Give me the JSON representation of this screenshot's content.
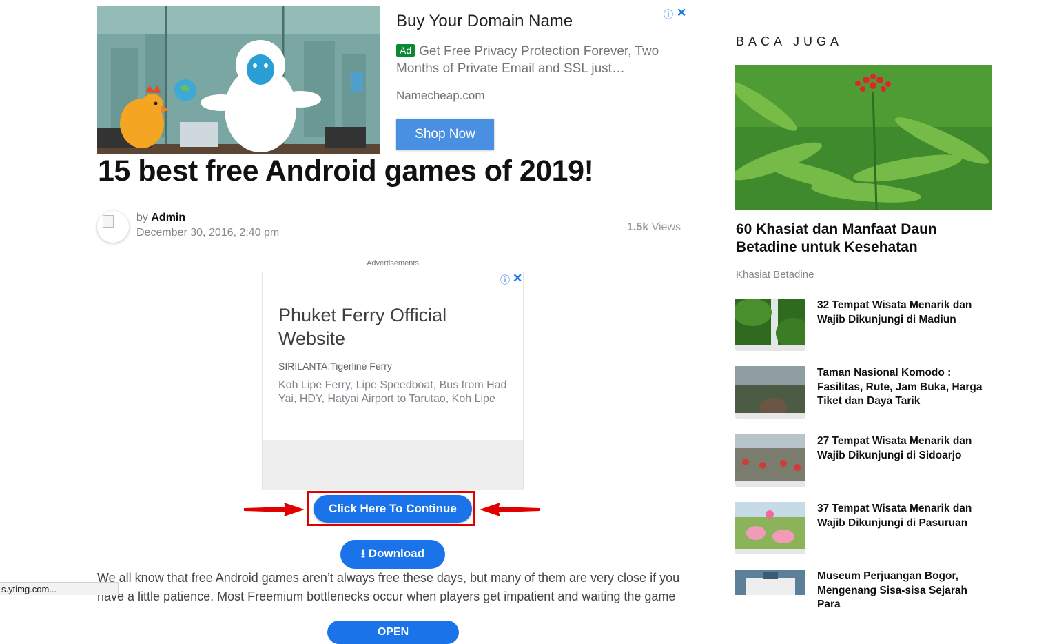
{
  "top_ad": {
    "title": "Buy Your Domain Name",
    "badge": "Ad",
    "text": "Get Free Privacy Protection Forever, Two Months of Private Email and SSL just…",
    "domain": "Namecheap.com",
    "cta": "Shop Now",
    "info_icon": "info-icon",
    "close_icon": "close-icon"
  },
  "article": {
    "title": "15 best free Android games of 2019!",
    "by_prefix": "by",
    "author": "Admin",
    "date": "December 30, 2016, 2:40 pm",
    "views_count": "1.5k",
    "views_label": "Views"
  },
  "mid_ad": {
    "label": "Advertisements",
    "title": "Phuket Ferry Official Website",
    "sub": "SIRILANTA:Tigerline Ferry",
    "desc": "Koh Lipe Ferry, Lipe Speedboat, Bus from Had Yai, HDY, Hatyai Airport to Tarutao, Koh Lipe",
    "cta": "OPEN"
  },
  "actions": {
    "continue": "Click Here To Continue",
    "download": "Download",
    "download_icon": "download-icon"
  },
  "body_text": "We all know that free Android games aren’t always free these days, but many of them are very close if you have a little patience. Most Freemium bottlenecks occur when players get impatient and waiting the game",
  "sidebar": {
    "heading": "BACA JUGA",
    "feature_title": "60 Khasiat dan Manfaat Daun Betadine untuk Kesehatan",
    "feature_category": "Khasiat Betadine",
    "items": [
      {
        "title": "32 Tempat Wisata Menarik dan Wajib Dikunjungi di Madiun"
      },
      {
        "title": "Taman Nasional Komodo : Fasilitas, Rute, Jam Buka, Harga Tiket dan Daya Tarik"
      },
      {
        "title": "27 Tempat Wisata Menarik dan Wajib Dikunjungi di Sidoarjo"
      },
      {
        "title": "37 Tempat Wisata Menarik dan Wajib Dikunjungi di Pasuruan"
      },
      {
        "title": "Museum Perjuangan Bogor, Mengenang Sisa-sisa Sejarah Para"
      }
    ]
  },
  "status_bar": "s.ytimg.com...",
  "colors": {
    "primary": "#1a73e8",
    "highlight": "#e00000",
    "ad_badge": "#0a8a33",
    "shop_button": "#4a90e2"
  }
}
